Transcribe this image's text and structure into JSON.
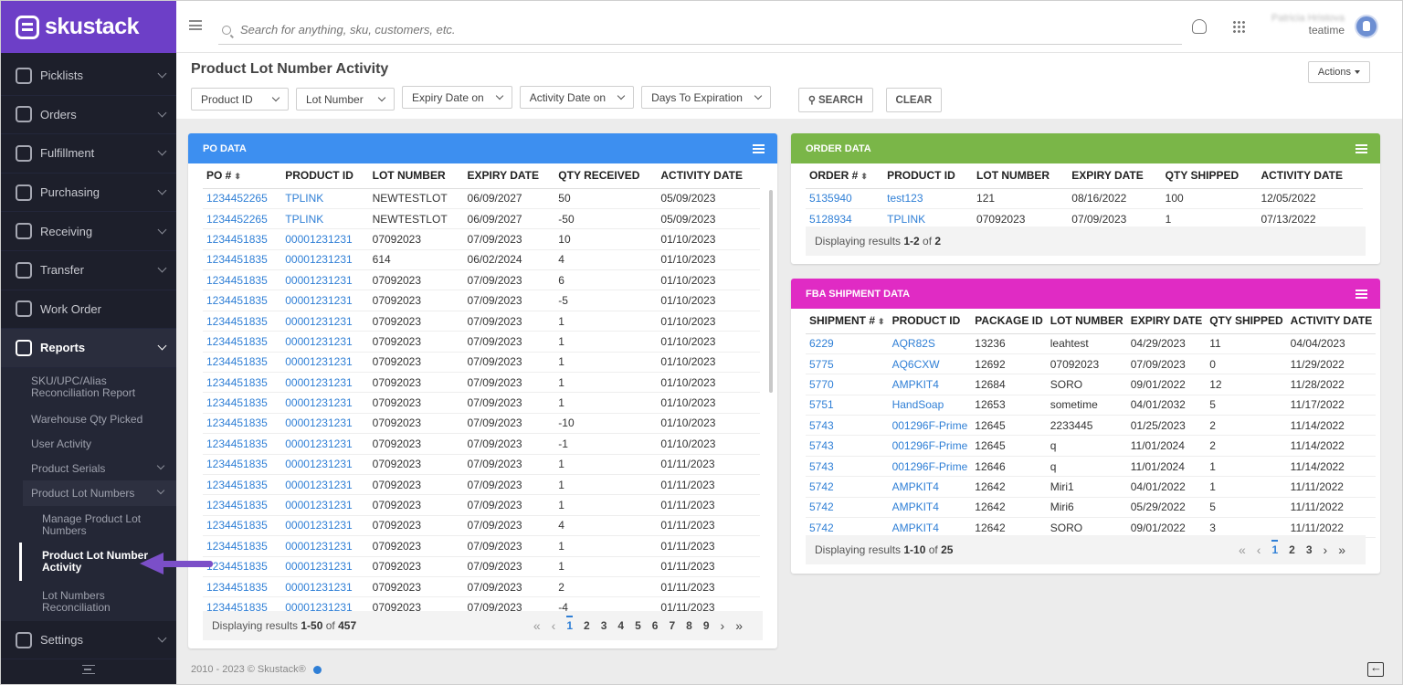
{
  "app": {
    "brand": "skustack"
  },
  "sidebar": {
    "items": [
      {
        "label": "Picklists"
      },
      {
        "label": "Orders"
      },
      {
        "label": "Fulfillment"
      },
      {
        "label": "Purchasing"
      },
      {
        "label": "Receiving"
      },
      {
        "label": "Transfer"
      },
      {
        "label": "Work Order"
      },
      {
        "label": "Reports"
      }
    ],
    "reports_sub": [
      "SKU/UPC/Alias Reconciliation Report",
      "Warehouse Qty Picked",
      "User Activity",
      "Product Serials",
      "Product Lot Numbers"
    ],
    "lot_sub": [
      "Manage Product Lot Numbers",
      "Product Lot Number Activity",
      "Lot Numbers Reconciliation"
    ],
    "settings": "Settings"
  },
  "topbar": {
    "search_placeholder": "Search for anything, sku, customers, etc.",
    "user_name": "Patricia Hristova",
    "org": "teatime"
  },
  "page": {
    "title": "Product Lot Number Activity",
    "actions": "Actions",
    "filters": [
      "Product ID",
      "Lot Number",
      "Expiry Date on",
      "Activity Date on",
      "Days To Expiration"
    ],
    "search_btn": "SEARCH",
    "clear_btn": "CLEAR"
  },
  "po": {
    "title": "PO DATA",
    "columns": [
      "PO #",
      "PRODUCT ID",
      "LOT NUMBER",
      "EXPIRY DATE",
      "QTY RECEIVED",
      "ACTIVITY DATE"
    ],
    "rows": [
      [
        "1234452265",
        "TPLINK",
        "NEWTESTLOT",
        "06/09/2027",
        "50",
        "05/09/2023"
      ],
      [
        "1234452265",
        "TPLINK",
        "NEWTESTLOT",
        "06/09/2027",
        "-50",
        "05/09/2023"
      ],
      [
        "1234451835",
        "00001231231",
        "07092023",
        "07/09/2023",
        "10",
        "01/10/2023"
      ],
      [
        "1234451835",
        "00001231231",
        "614",
        "06/02/2024",
        "4",
        "01/10/2023"
      ],
      [
        "1234451835",
        "00001231231",
        "07092023",
        "07/09/2023",
        "6",
        "01/10/2023"
      ],
      [
        "1234451835",
        "00001231231",
        "07092023",
        "07/09/2023",
        "-5",
        "01/10/2023"
      ],
      [
        "1234451835",
        "00001231231",
        "07092023",
        "07/09/2023",
        "1",
        "01/10/2023"
      ],
      [
        "1234451835",
        "00001231231",
        "07092023",
        "07/09/2023",
        "1",
        "01/10/2023"
      ],
      [
        "1234451835",
        "00001231231",
        "07092023",
        "07/09/2023",
        "1",
        "01/10/2023"
      ],
      [
        "1234451835",
        "00001231231",
        "07092023",
        "07/09/2023",
        "1",
        "01/10/2023"
      ],
      [
        "1234451835",
        "00001231231",
        "07092023",
        "07/09/2023",
        "1",
        "01/10/2023"
      ],
      [
        "1234451835",
        "00001231231",
        "07092023",
        "07/09/2023",
        "-10",
        "01/10/2023"
      ],
      [
        "1234451835",
        "00001231231",
        "07092023",
        "07/09/2023",
        "-1",
        "01/10/2023"
      ],
      [
        "1234451835",
        "00001231231",
        "07092023",
        "07/09/2023",
        "1",
        "01/11/2023"
      ],
      [
        "1234451835",
        "00001231231",
        "07092023",
        "07/09/2023",
        "1",
        "01/11/2023"
      ],
      [
        "1234451835",
        "00001231231",
        "07092023",
        "07/09/2023",
        "1",
        "01/11/2023"
      ],
      [
        "1234451835",
        "00001231231",
        "07092023",
        "07/09/2023",
        "4",
        "01/11/2023"
      ],
      [
        "1234451835",
        "00001231231",
        "07092023",
        "07/09/2023",
        "1",
        "01/11/2023"
      ],
      [
        "1234451835",
        "00001231231",
        "07092023",
        "07/09/2023",
        "1",
        "01/11/2023"
      ],
      [
        "1234451835",
        "00001231231",
        "07092023",
        "07/09/2023",
        "2",
        "01/11/2023"
      ],
      [
        "1234451835",
        "00001231231",
        "07092023",
        "07/09/2023",
        "-4",
        "01/11/2023"
      ]
    ],
    "footer": {
      "pre": "Displaying results ",
      "range": "1-50",
      "of": " of ",
      "total": "457"
    },
    "pages": [
      "1",
      "2",
      "3",
      "4",
      "5",
      "6",
      "7",
      "8",
      "9"
    ]
  },
  "order": {
    "title": "ORDER DATA",
    "columns": [
      "ORDER #",
      "PRODUCT ID",
      "LOT NUMBER",
      "EXPIRY DATE",
      "QTY SHIPPED",
      "ACTIVITY DATE"
    ],
    "rows": [
      [
        "5135940",
        "test123",
        "121",
        "08/16/2022",
        "100",
        "12/05/2022"
      ],
      [
        "5128934",
        "TPLINK",
        "07092023",
        "07/09/2023",
        "1",
        "07/13/2022"
      ]
    ],
    "footer": {
      "pre": "Displaying results ",
      "range": "1-2",
      "of": " of ",
      "total": "2"
    }
  },
  "fba": {
    "title": "FBA SHIPMENT DATA",
    "columns": [
      "SHIPMENT #",
      "PRODUCT ID",
      "PACKAGE ID",
      "LOT NUMBER",
      "EXPIRY DATE",
      "QTY SHIPPED",
      "ACTIVITY DATE"
    ],
    "rows": [
      [
        "6229",
        "AQR82S",
        "13236",
        "leahtest",
        "04/29/2023",
        "11",
        "04/04/2023"
      ],
      [
        "5775",
        "AQ6CXW",
        "12692",
        "07092023",
        "07/09/2023",
        "0",
        "11/29/2022"
      ],
      [
        "5770",
        "AMPKIT4",
        "12684",
        "SORO",
        "09/01/2022",
        "12",
        "11/28/2022"
      ],
      [
        "5751",
        "HandSoap",
        "12653",
        "sometime",
        "04/01/2032",
        "5",
        "11/17/2022"
      ],
      [
        "5743",
        "001296F-Prime",
        "12645",
        "2233445",
        "01/25/2023",
        "2",
        "11/14/2022"
      ],
      [
        "5743",
        "001296F-Prime",
        "12645",
        "q",
        "11/01/2024",
        "2",
        "11/14/2022"
      ],
      [
        "5743",
        "001296F-Prime",
        "12646",
        "q",
        "11/01/2024",
        "1",
        "11/14/2022"
      ],
      [
        "5742",
        "AMPKIT4",
        "12642",
        "Miri1",
        "04/01/2022",
        "1",
        "11/11/2022"
      ],
      [
        "5742",
        "AMPKIT4",
        "12642",
        "Miri6",
        "05/29/2022",
        "5",
        "11/11/2022"
      ],
      [
        "5742",
        "AMPKIT4",
        "12642",
        "SORO",
        "09/01/2022",
        "3",
        "11/11/2022"
      ]
    ],
    "footer": {
      "pre": "Displaying results ",
      "range": "1-10",
      "of": " of ",
      "total": "25"
    },
    "pages": [
      "1",
      "2",
      "3"
    ]
  },
  "footer": {
    "copyright": "2010 - 2023 © Skustack®"
  },
  "colors": {
    "brand": "#6d3fc7",
    "po": "#3d8ff0",
    "order": "#7ab648",
    "fba": "#e02bc4",
    "link": "#2f7fd6"
  }
}
